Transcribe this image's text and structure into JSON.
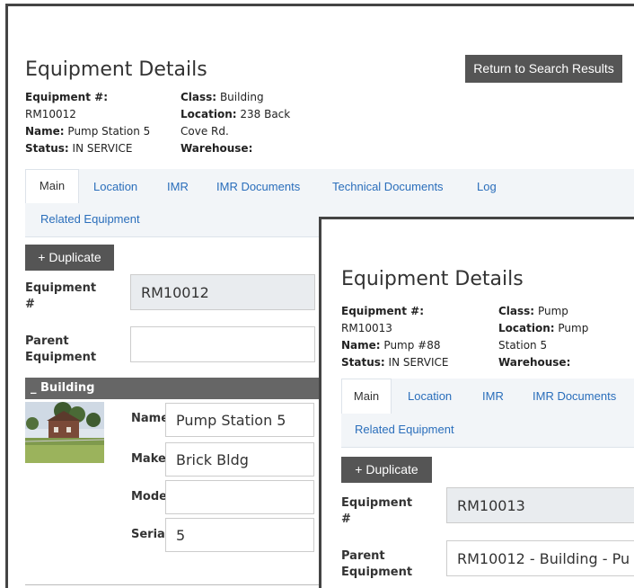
{
  "back": {
    "title": "Equipment Details",
    "return_button": "Return to Search Results",
    "equipment_label": "Equipment #:",
    "equipment_value": "RM10012",
    "name_label": "Name:",
    "name_value": "Pump Station 5",
    "status_label": "Status:",
    "status_value": "IN SERVICE",
    "class_label": "Class:",
    "class_value": "Building",
    "location_label": "Location:",
    "location_value_1": "238 Back",
    "location_value_2": "Cove Rd.",
    "warehouse_label": "Warehouse:",
    "tabs": [
      "Main",
      "Location",
      "IMR",
      "IMR Documents",
      "Technical Documents",
      "Log",
      "Related Equipment"
    ],
    "duplicate_button": "+ Duplicate",
    "field_equipment_label_1": "Equipment",
    "field_equipment_label_2": "#",
    "field_equipment_value": "RM10012",
    "field_parent_label_1": "Parent",
    "field_parent_label_2": "Equipment",
    "field_parent_value": "",
    "section_title": "_ Building",
    "sub_fields": {
      "name_label": "Name",
      "name_value": "Pump Station 5",
      "make_label": "Make",
      "make_value": "Brick Bldg",
      "model_label": "Mode",
      "model_value": "",
      "serial_label": "Serial",
      "serial_value": "5"
    }
  },
  "front": {
    "title": "Equipment Details",
    "equipment_label": "Equipment #:",
    "equipment_value": "RM10013",
    "name_label": "Name:",
    "name_value": "Pump #88",
    "status_label": "Status:",
    "status_value": "IN SERVICE",
    "class_label": "Class:",
    "class_value": "Pump",
    "location_label": "Location:",
    "location_value_1": "Pump",
    "location_value_2": "Station 5",
    "warehouse_label": "Warehouse:",
    "tabs": [
      "Main",
      "Location",
      "IMR",
      "IMR Documents",
      "Related Equipment"
    ],
    "duplicate_button": "+ Duplicate",
    "field_equipment_label_1": "Equipment",
    "field_equipment_label_2": "#",
    "field_equipment_value": "RM10013",
    "field_parent_label_1": "Parent",
    "field_parent_label_2": "Equipment",
    "field_parent_value": "RM10012 - Building - Pu"
  },
  "colors": {
    "accent": "#2a6ebb",
    "button_bg": "#555555",
    "section_bar": "#666666"
  }
}
